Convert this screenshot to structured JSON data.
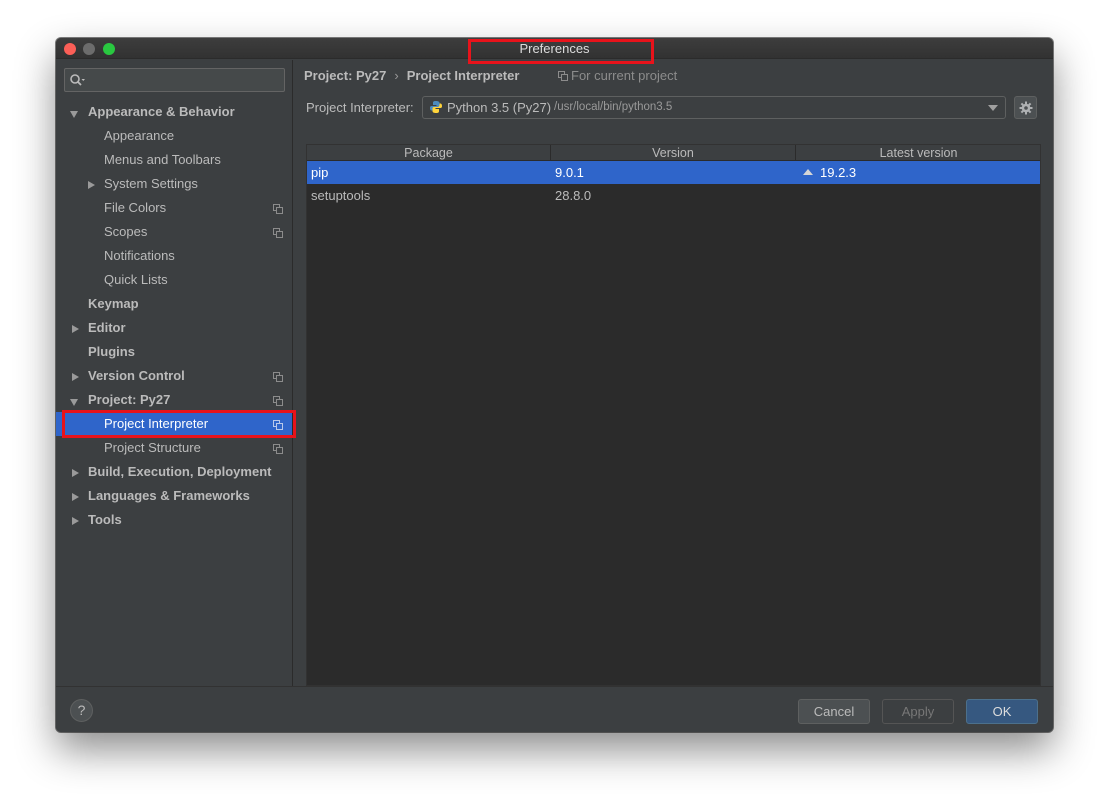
{
  "window": {
    "title": "Preferences"
  },
  "search": {
    "placeholder": ""
  },
  "sidebar": {
    "items": [
      {
        "label": "Appearance & Behavior"
      },
      {
        "label": "Appearance"
      },
      {
        "label": "Menus and Toolbars"
      },
      {
        "label": "System Settings"
      },
      {
        "label": "File Colors"
      },
      {
        "label": "Scopes"
      },
      {
        "label": "Notifications"
      },
      {
        "label": "Quick Lists"
      },
      {
        "label": "Keymap"
      },
      {
        "label": "Editor"
      },
      {
        "label": "Plugins"
      },
      {
        "label": "Version Control"
      },
      {
        "label": "Project: Py27"
      },
      {
        "label": "Project Interpreter"
      },
      {
        "label": "Project Structure"
      },
      {
        "label": "Build, Execution, Deployment"
      },
      {
        "label": "Languages & Frameworks"
      },
      {
        "label": "Tools"
      }
    ]
  },
  "breadcrumb": {
    "parent": "Project: Py27",
    "separator": "›",
    "current": "Project Interpreter"
  },
  "scope_note": "For current project",
  "interpreter": {
    "label": "Project Interpreter:",
    "name": "Python 3.5 (Py27)",
    "path": "/usr/local/bin/python3.5"
  },
  "packages": {
    "columns": [
      "Package",
      "Version",
      "Latest version"
    ],
    "rows": [
      {
        "package": "pip",
        "version": "9.0.1",
        "latest": "19.2.3"
      },
      {
        "package": "setuptools",
        "version": "28.8.0",
        "latest": ""
      }
    ]
  },
  "toolbar": {
    "add": "+",
    "remove": "−"
  },
  "footer": {
    "help": "?",
    "cancel": "Cancel",
    "apply": "Apply",
    "ok": "OK"
  },
  "colors": {
    "accent": "#2f65ca",
    "highlight": "#e8131b",
    "ok_button": "#365880"
  }
}
